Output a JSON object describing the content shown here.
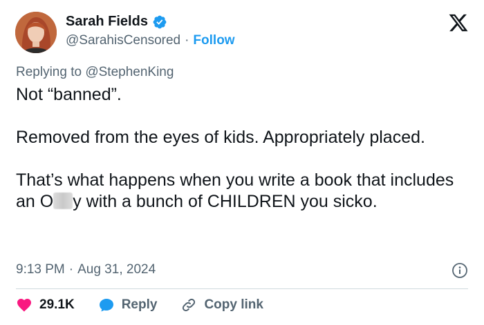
{
  "author": {
    "name": "Sarah Fields",
    "handle": "@SarahisCensored",
    "separator": "·",
    "follow_label": "Follow"
  },
  "reply": {
    "prefix": "Replying to",
    "mention": "@StephenKing"
  },
  "tweet": {
    "line1": "Not “banned”.",
    "line2": "Removed from the eyes of kids. Appropriately placed.",
    "line3_before": "That’s what happens when you write a book that includes an O",
    "line3_after": "y with a bunch of CHILDREN you sicko."
  },
  "meta": {
    "time": "9:13 PM",
    "separator": "·",
    "date": "Aug 31, 2024"
  },
  "actions": {
    "likes": "29.1K",
    "reply_label": "Reply",
    "copy_link_label": "Copy link"
  },
  "colors": {
    "accent": "#1d9bf0",
    "like": "#f91880",
    "muted": "#536471",
    "text": "#0f1419"
  }
}
